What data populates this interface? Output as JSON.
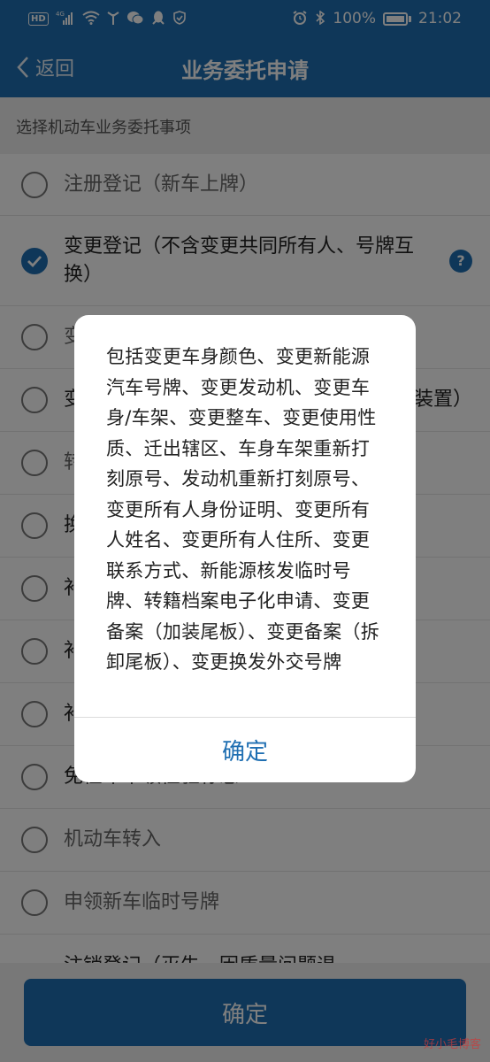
{
  "status_bar": {
    "left_icons": [
      "hd-icon",
      "signal-4g-icon",
      "wifi-icon",
      "antenna-icon",
      "wechat-icon",
      "qq-icon",
      "shield-icon"
    ],
    "hd_label": "HD",
    "battery_text": "100%",
    "time": "21:02"
  },
  "header": {
    "back_label": "返回",
    "title": "业务委托申请"
  },
  "section_title": "选择机动车业务委托事项",
  "items": [
    {
      "label": "注册登记（新车上牌）",
      "checked": false
    },
    {
      "label": "变更登记（不含变更共同所有人、号牌互换）",
      "checked": true,
      "has_help": true
    },
    {
      "label": "变",
      "checked": false
    },
    {
      "label": "变",
      "trail": "装置）",
      "checked": false
    },
    {
      "label": "转",
      "checked": false
    },
    {
      "label": "换",
      "checked": false
    },
    {
      "label": "补",
      "checked": false
    },
    {
      "label": "补",
      "checked": false
    },
    {
      "label": "补",
      "checked": false
    },
    {
      "label": "免检车申领检验标志",
      "checked": false
    },
    {
      "label": "机动车转入",
      "checked": false
    },
    {
      "label": "申领新车临时号牌",
      "checked": false
    },
    {
      "label": "注销登记（灭失、因质量问题退",
      "checked": false
    }
  ],
  "help_label": "?",
  "footer_button": "确定",
  "dialog": {
    "text": "包括变更车身颜色、变更新能源汽车号牌、变更发动机、变更车身/车架、变更整车、变更使用性质、迁出辖区、车身车架重新打刻原号、发动机重新打刻原号、变更所有人身份证明、变更所有人姓名、变更所有人住所、变更联系方式、新能源核发临时号牌、转籍档案电子化申请、变更备案（加装尾板）、变更备案（拆卸尾板）、变更换发外交号牌",
    "ok_label": "确定"
  },
  "watermark": "好小毛博客",
  "colors": {
    "primary": "#1f6fb2",
    "overlay": "rgba(0,0,0,0.5)"
  }
}
